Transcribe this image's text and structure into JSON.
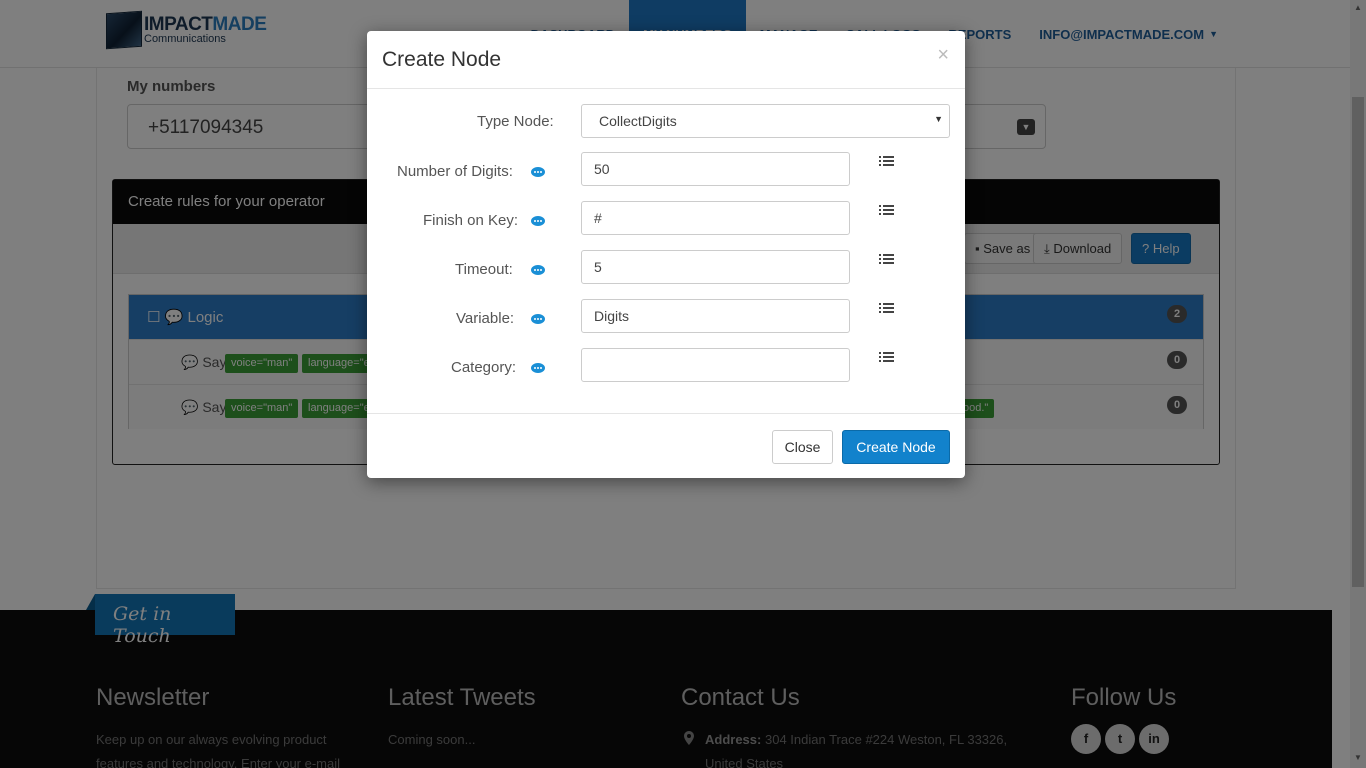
{
  "brand": {
    "name_part1": "IMPACT",
    "name_part2": "MADE",
    "tagline": "Communications"
  },
  "nav": {
    "items": [
      {
        "label": "DASHBOARD"
      },
      {
        "label": "MY NUMBERS"
      },
      {
        "label": "MANAGE"
      },
      {
        "label": "CALL LOGS"
      },
      {
        "label": "REPORTS"
      },
      {
        "label": "INFO@IMPACTMADE.COM"
      }
    ],
    "active_index": 1
  },
  "page": {
    "mynumbers_label": "My numbers",
    "selected_number": "+5117094345",
    "rules_title": "Create rules for your operator",
    "toolbar": {
      "save_as": "Save as",
      "download": "Download",
      "help": "Help"
    },
    "logic": {
      "label": "Logic",
      "count": "2",
      "rows": [
        {
          "say": "Say",
          "tag1": "voice=\"man\"",
          "tag2": "language=\"e",
          "count": "0",
          "tail": ""
        },
        {
          "say": "Say",
          "tag1": "voice=\"man\"",
          "tag2": "language=\"e",
          "count": "0",
          "tail": "ood.\""
        }
      ]
    }
  },
  "footer": {
    "get_in_touch": "Get in Touch",
    "newsletter_title": "Newsletter",
    "newsletter_text_1": "Keep up on our always evolving product",
    "newsletter_text_2": "features and technology. Enter your e-mail",
    "tweets_title": "Latest Tweets",
    "tweets_text": "Coming soon...",
    "contact_title": "Contact Us",
    "address_label": "Address:",
    "address_line_1": "304 Indian Trace #224 Weston, FL 33326,",
    "address_line_2": "United States",
    "follow_title": "Follow Us",
    "social": [
      "f",
      "t",
      "in"
    ]
  },
  "modal": {
    "title": "Create Node",
    "close_x": "×",
    "fields": {
      "type_node_label": "Type Node:",
      "type_node_value": "CollectDigits",
      "num_digits_label": "Number of Digits:",
      "num_digits_value": "50",
      "finish_key_label": "Finish on Key:",
      "finish_key_value": "#",
      "timeout_label": "Timeout:",
      "timeout_value": "5",
      "variable_label": "Variable:",
      "variable_value": "Digits",
      "category_label": "Category:",
      "category_value": ""
    },
    "close_button": "Close",
    "create_button": "Create Node"
  },
  "colors": {
    "primary": "#1282cc",
    "tag_green": "#3a9f36",
    "footer_bg": "#0c0c0c",
    "panel_blue": "#2d7cc9"
  }
}
